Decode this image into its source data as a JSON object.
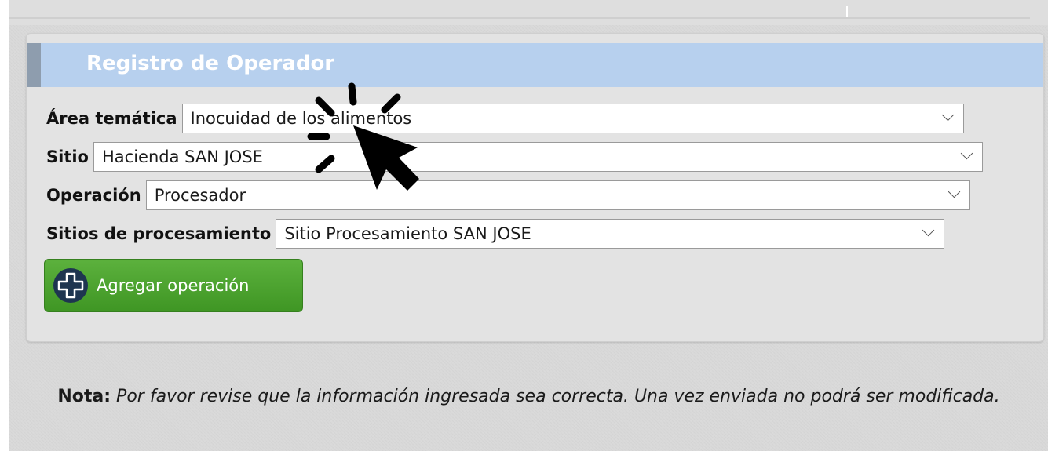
{
  "panel": {
    "title": "Registro de Operador"
  },
  "form": {
    "area": {
      "label": "Área temática",
      "value": "Inocuidad de los alimentos"
    },
    "sitio": {
      "label": "Sitio",
      "value": "Hacienda SAN JOSE"
    },
    "operacion": {
      "label": "Operación",
      "value": "Procesador"
    },
    "sitios_procesamiento": {
      "label": "Sitios de procesamiento",
      "value": "Sitio Procesamiento SAN JOSE"
    }
  },
  "actions": {
    "add_operation_label": "Agregar operación"
  },
  "note": {
    "label": "Nota:",
    "text": " Por favor revise que la información ingresada sea correcta. Una vez enviada no podrá ser modificada."
  },
  "icons": {
    "add": "plus-circle-icon",
    "select": "chevron-down-icon",
    "cursor": "click-cursor-icon"
  },
  "colors": {
    "header_bg": "#b7d0ee",
    "header_accent": "#8e9dae",
    "button_green": "#4aa32e",
    "icon_navy": "#1e3550"
  }
}
